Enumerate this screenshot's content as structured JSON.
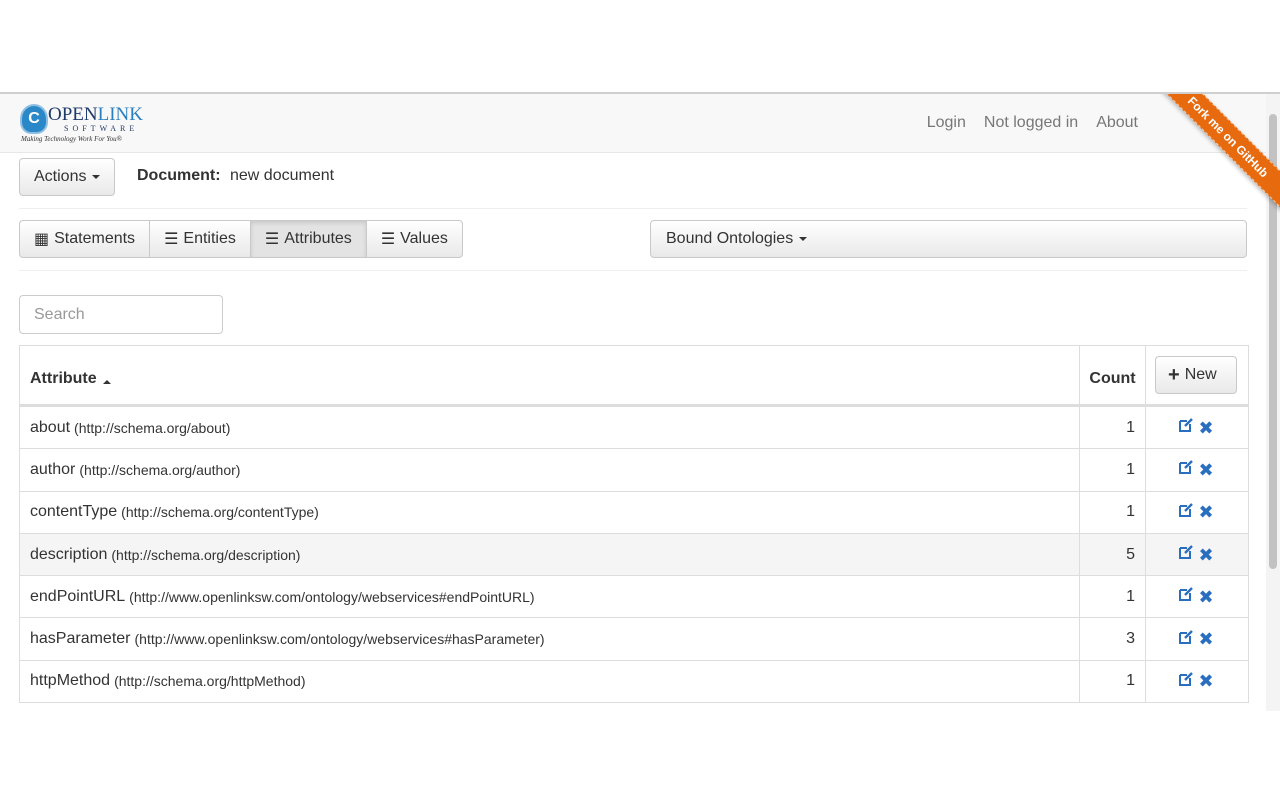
{
  "navbar": {
    "logo": {
      "mark": "C",
      "name_a": "OPEN",
      "name_b": "LINK",
      "sub": "SOFTWARE",
      "tagline": "Making Technology Work For You®"
    },
    "links": [
      "Login",
      "Not logged in",
      "About"
    ],
    "ribbon": "Fork me on GitHub"
  },
  "toolbar": {
    "actions_label": "Actions",
    "document_label": "Document:",
    "document_value": "new document"
  },
  "tabs": [
    {
      "label": "Statements",
      "icon": "th-icon",
      "glyph": "▦"
    },
    {
      "label": "Entities",
      "icon": "list-icon",
      "glyph": "☰"
    },
    {
      "label": "Attributes",
      "icon": "list-icon",
      "glyph": "☰"
    },
    {
      "label": "Values",
      "icon": "list-icon",
      "glyph": "☰"
    }
  ],
  "active_tab": "Attributes",
  "bound_ontologies_label": "Bound Ontologies",
  "search": {
    "placeholder": "Search",
    "value": ""
  },
  "table": {
    "headers": {
      "attribute": "Attribute",
      "count": "Count",
      "new": "New"
    },
    "rows": [
      {
        "name": "about",
        "uri": "(http://schema.org/about)",
        "count": "1"
      },
      {
        "name": "author",
        "uri": "(http://schema.org/author)",
        "count": "1"
      },
      {
        "name": "contentType",
        "uri": "(http://schema.org/contentType)",
        "count": "1"
      },
      {
        "name": "description",
        "uri": "(http://schema.org/description)",
        "count": "5"
      },
      {
        "name": "endPointURL",
        "uri": "(http://www.openlinksw.com/ontology/webservices#endPointURL)",
        "count": "1"
      },
      {
        "name": "hasParameter",
        "uri": "(http://www.openlinksw.com/ontology/webservices#hasParameter)",
        "count": "3"
      },
      {
        "name": "httpMethod",
        "uri": "(http://schema.org/httpMethod)",
        "count": "1"
      }
    ]
  },
  "colors": {
    "accent": "#2a6fbf",
    "ribbon": "#e86a0f"
  }
}
